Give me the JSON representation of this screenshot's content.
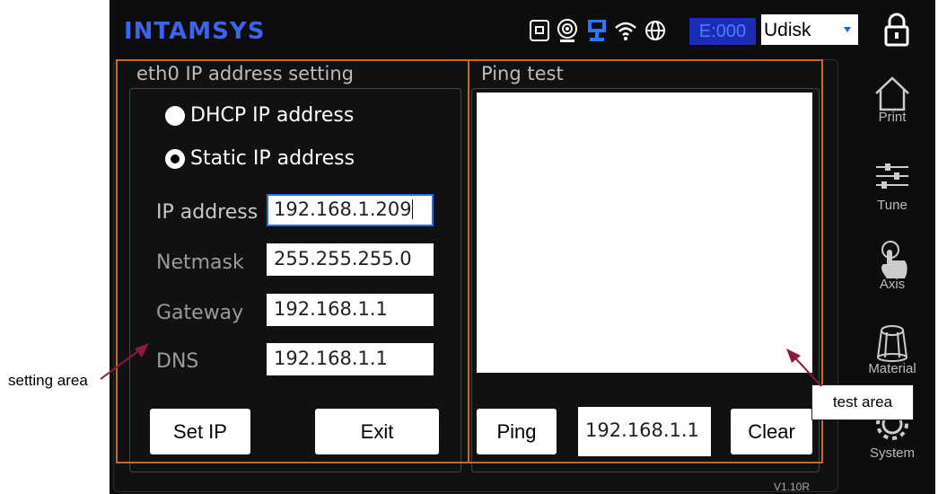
{
  "topbar": {
    "brand": "INTAMSYS",
    "error_code": "E:000",
    "storage_select": {
      "value": "Udisk"
    },
    "status_icons": [
      "memory-card-icon",
      "camera-icon",
      "ethernet-icon",
      "wifi-icon",
      "globe-icon"
    ],
    "lock_icon": "lock-icon"
  },
  "ip_setting": {
    "title": "eth0 IP address setting",
    "mode_options": [
      {
        "label": "DHCP IP address",
        "selected": false
      },
      {
        "label": "Static IP address",
        "selected": true
      }
    ],
    "fields": [
      {
        "label": "IP address",
        "value": "192.168.1.209"
      },
      {
        "label": "Netmask",
        "value": "255.255.255.0"
      },
      {
        "label": "Gateway",
        "value": "192.168.1.1"
      },
      {
        "label": "DNS",
        "value": "192.168.1.1"
      }
    ],
    "set_ip_label": "Set IP",
    "exit_label": "Exit"
  },
  "ping_test": {
    "title": "Ping test",
    "ping_label": "Ping",
    "target_value": "192.168.1.1",
    "clear_label": "Clear"
  },
  "side_nav": [
    {
      "label": "Print",
      "icon": "home-icon"
    },
    {
      "label": "Tune",
      "icon": "sliders-icon"
    },
    {
      "label": "Axis",
      "icon": "hand-pointer-icon"
    },
    {
      "label": "Material",
      "icon": "spool-icon"
    },
    {
      "label": "System",
      "icon": "gear-icon"
    }
  ],
  "version": "V1.10R",
  "annotations": {
    "setting_area": "setting area",
    "test_area": "test area"
  },
  "colors": {
    "brand": "#3c63e8",
    "highlight_box": "#c8692a",
    "arrow": "#8b1a3c",
    "error_code_bg": "#1a2eb5"
  }
}
